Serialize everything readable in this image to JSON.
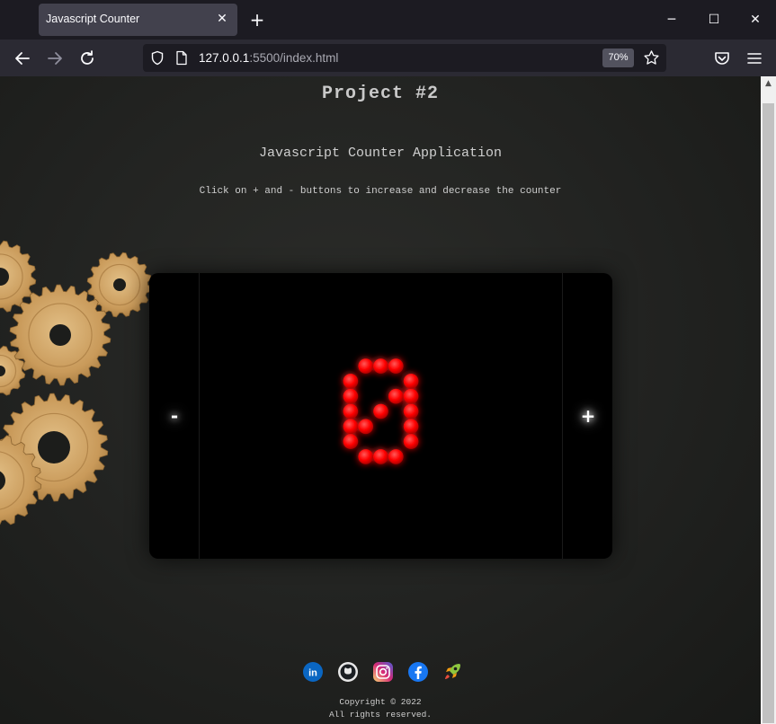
{
  "browser": {
    "tab_title": "Javascript Counter",
    "url_host": "127.0.0.1",
    "url_rest": ":5500/index.html",
    "zoom": "70%"
  },
  "page": {
    "title": "Project #2",
    "subtitle": "Javascript Counter Application",
    "description": "Click on + and - buttons to increase and decrease the counter",
    "decrement_label": "-",
    "increment_label": "+",
    "counter_value": 0,
    "copyright_line1": "Copyright © 2022",
    "copyright_line2": "All rights reserved."
  },
  "socials": [
    {
      "name": "linkedin-icon",
      "color": "#0a66c2"
    },
    {
      "name": "github-icon",
      "color": "#1b1f23"
    },
    {
      "name": "instagram-icon",
      "color": "#e1306c"
    },
    {
      "name": "facebook-icon",
      "color": "#1877f2"
    },
    {
      "name": "rocket-icon",
      "color": "#9acd32"
    }
  ],
  "colors": {
    "led": "#ff0000",
    "counter_bg": "#000000"
  }
}
